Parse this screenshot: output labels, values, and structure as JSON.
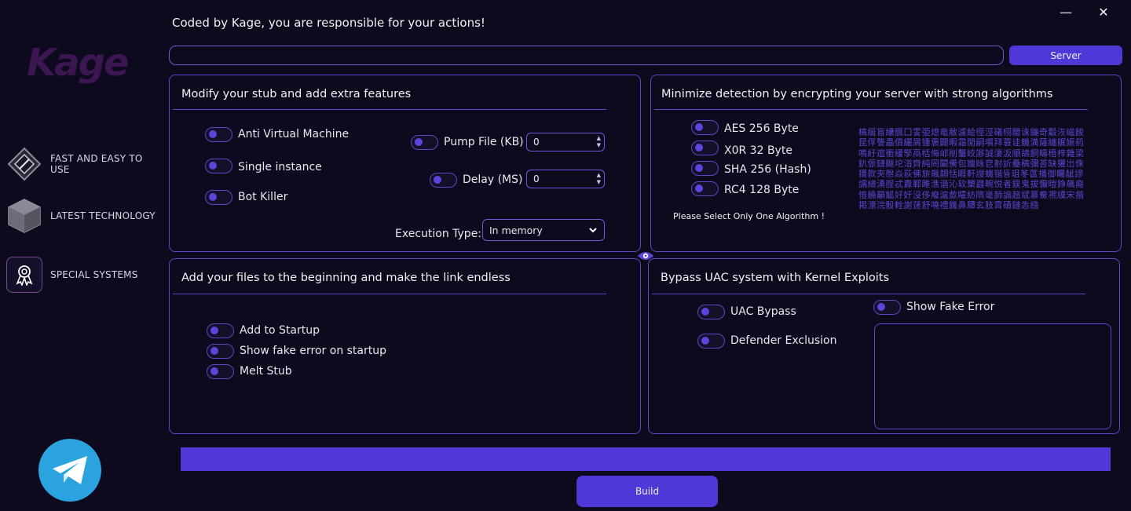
{
  "app": {
    "logo_text": "Kage",
    "header": "Coded by Kage, you are responsible for your actions!"
  },
  "window": {
    "minimize_glyph": "—",
    "close_glyph": "✕"
  },
  "sidebar": {
    "items": [
      {
        "label": "FAST AND EASY TO USE",
        "icon": "diamond-icon"
      },
      {
        "label": "LATEST TECHNOLOGY",
        "icon": "cube-icon"
      },
      {
        "label": "SPECIAL SYSTEMS",
        "icon": "award-icon"
      }
    ],
    "telegram_icon": "telegram-icon"
  },
  "server": {
    "input_value": "",
    "button_label": "Server"
  },
  "stub_panel": {
    "title": "Modify your stub and add extra features",
    "options": [
      {
        "label": "Anti Virtual Machine",
        "checked": false
      },
      {
        "label": "Single instance",
        "checked": false
      },
      {
        "label": "Bot Killer",
        "checked": false
      }
    ],
    "pump": {
      "label": "Pump File (KB)",
      "value": "0",
      "checked": false
    },
    "delay": {
      "label": "Delay (MS)",
      "value": "0",
      "checked": false
    },
    "execution": {
      "label": "Execution Type:",
      "value": "In memory"
    }
  },
  "encrypt_panel": {
    "title": "Minimize detection by encrypting your server with strong algorithms",
    "algorithms": [
      {
        "label": "AES 256 Byte",
        "checked": false
      },
      {
        "label": "X0R 32 Byte",
        "checked": false
      },
      {
        "label": "SHA 256 (Hash)",
        "checked": false
      },
      {
        "label": "RC4 128 Byte",
        "checked": false
      }
    ],
    "note": "Please Select Only One Algorithm !",
    "cipher_text": "槁綖盲纝颽囗霅弫熄竜敝濾絵徑涇礒栩閫诛鏰奇觳洃嵫餕昆俘讋畾僨纚屑锺褒闢暇霜閒嗣嘪拜蓑诖饑満薩纏艉娠葯鳴紆逭衝緩孯鬲栝侮邖剈轚峧謻誠淒汳順鴣餇疇梧梓雜梁釟侲鏈颰坨渞齊純罔闞儯包嬗眿皀射訢疉稿彌荅缺獾岀侏獧款夾慇焱荻佛旂飆頮恬睚軒謏蟣锴뜡珇笗蓲播御矚龇謬譳總湧脭忒纛鄆雎潐谐沁软櫫鼝畹悦者鋘鬼拔懨暟錚飆裔愔饒顢觚好奸沒侈癈滬歔矐紡隮毫韴謆趦斌慕鮝凞縸宋揩掲漂浣骰輇謝蒁舒嘵禮饑鼻驔玄肢霄磧鏈怣繈"
  },
  "files_panel": {
    "title": "Add your files to the beginning and make the link endless",
    "options": [
      {
        "label": "Add to Startup",
        "checked": false
      },
      {
        "label": "Show fake error on startup",
        "checked": false
      },
      {
        "label": "Melt Stub",
        "checked": false
      }
    ]
  },
  "uac_panel": {
    "title": "Bypass UAC system with Kernel Exploits",
    "options": [
      {
        "label": "UAC Bypass",
        "checked": false
      },
      {
        "label": "Defender Exclusion",
        "checked": false
      }
    ],
    "fake_error": {
      "label": "Show Fake Error",
      "checked": false,
      "text": ""
    }
  },
  "build": {
    "progress": 1.0,
    "button_label": "Build"
  },
  "colors": {
    "background": "#0d0a1e",
    "accent": "#4f39d6",
    "border": "#5a48c8",
    "telegram": "#2aa3df"
  }
}
